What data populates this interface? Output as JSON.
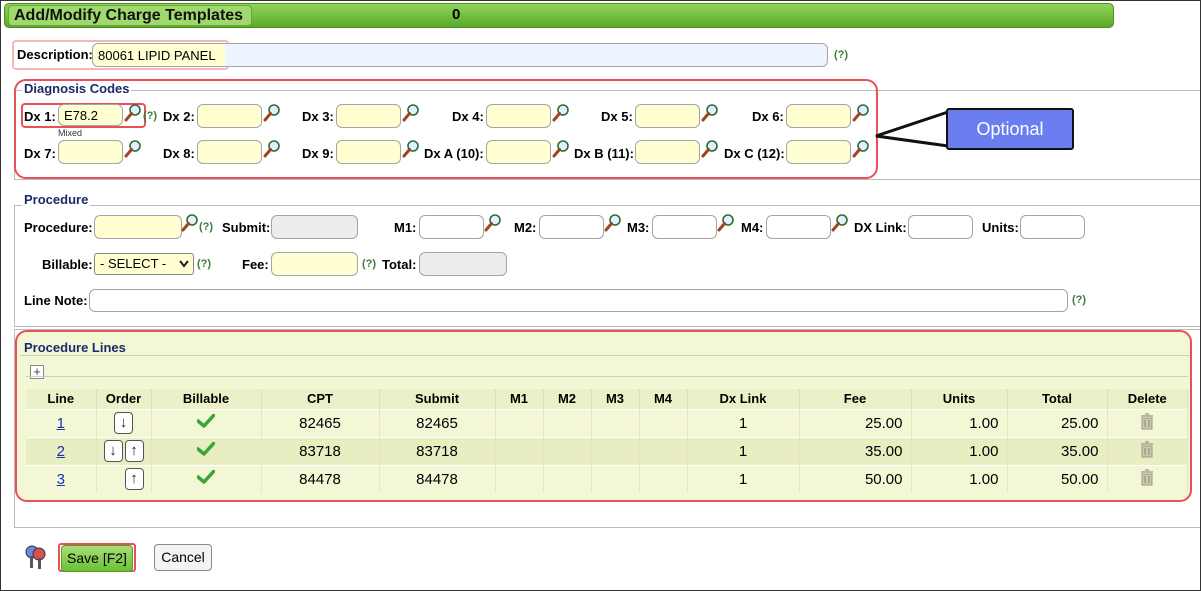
{
  "header": {
    "title": "Add/Modify Charge Templates",
    "count": "0"
  },
  "description": {
    "label": "Description:",
    "value": "80061 LIPID PANEL",
    "help": "(?)"
  },
  "diagnosis": {
    "legend": "Diagnosis Codes",
    "dx1": {
      "label": "Dx 1:",
      "value": "E78.2",
      "note": "Mixed",
      "help": "(?)"
    },
    "dx2": "Dx 2:",
    "dx3": "Dx 3:",
    "dx4": "Dx 4:",
    "dx5": "Dx 5:",
    "dx6": "Dx 6:",
    "dx7": "Dx 7:",
    "dx8": "Dx 8:",
    "dx9": "Dx 9:",
    "dx10": "Dx A (10):",
    "dx11": "Dx B (11):",
    "dx12": "Dx C (12):"
  },
  "callout": "Optional",
  "procedure": {
    "legend": "Procedure",
    "procedure_label": "Procedure:",
    "submit_label": "Submit:",
    "m1": "M1:",
    "m2": "M2:",
    "m3": "M3:",
    "m4": "M4:",
    "dxlink": "DX Link:",
    "units": "Units:",
    "billable_label": "Billable:",
    "billable_value": "- SELECT -",
    "fee_label": "Fee:",
    "total_label": "Total:",
    "linenote_label": "Line Note:",
    "help": "(?)"
  },
  "lines": {
    "legend": "Procedure Lines",
    "headers": [
      "Line",
      "Order",
      "Billable",
      "CPT",
      "Submit",
      "M1",
      "M2",
      "M3",
      "M4",
      "Dx Link",
      "Fee",
      "Units",
      "Total",
      "Delete"
    ],
    "rows": [
      {
        "line": "1",
        "cpt": "82465",
        "submit": "82465",
        "dxlink": "1",
        "fee": "25.00",
        "units": "1.00",
        "total": "25.00"
      },
      {
        "line": "2",
        "cpt": "83718",
        "submit": "83718",
        "dxlink": "1",
        "fee": "35.00",
        "units": "1.00",
        "total": "35.00"
      },
      {
        "line": "3",
        "cpt": "84478",
        "submit": "84478",
        "dxlink": "1",
        "fee": "50.00",
        "units": "1.00",
        "total": "50.00"
      }
    ]
  },
  "buttons": {
    "save": "Save [F2]",
    "cancel": "Cancel"
  }
}
